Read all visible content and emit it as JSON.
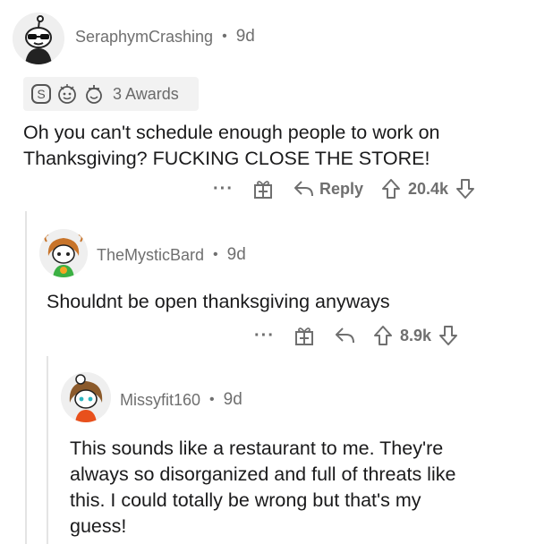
{
  "comments": [
    {
      "username": "SeraphymCrashing",
      "age": "9d",
      "awards_label": "3 Awards",
      "body": "Oh you can't schedule enough people to work on\nThanksgiving? FUCKING CLOSE THE STORE!",
      "reply_label": "Reply",
      "score": "20.4k"
    },
    {
      "username": "TheMysticBard",
      "age": "9d",
      "body": "Shouldnt be open thanksgiving anyways",
      "score": "8.9k"
    },
    {
      "username": "Missyfit160",
      "age": "9d",
      "body": "This sounds like a restaurant to me. They're\nalways so disorganized and full of threats like\nthis. I could totally be wrong but that's my\nguess!"
    }
  ],
  "ui": {
    "separator": "•",
    "more_label": "···"
  }
}
